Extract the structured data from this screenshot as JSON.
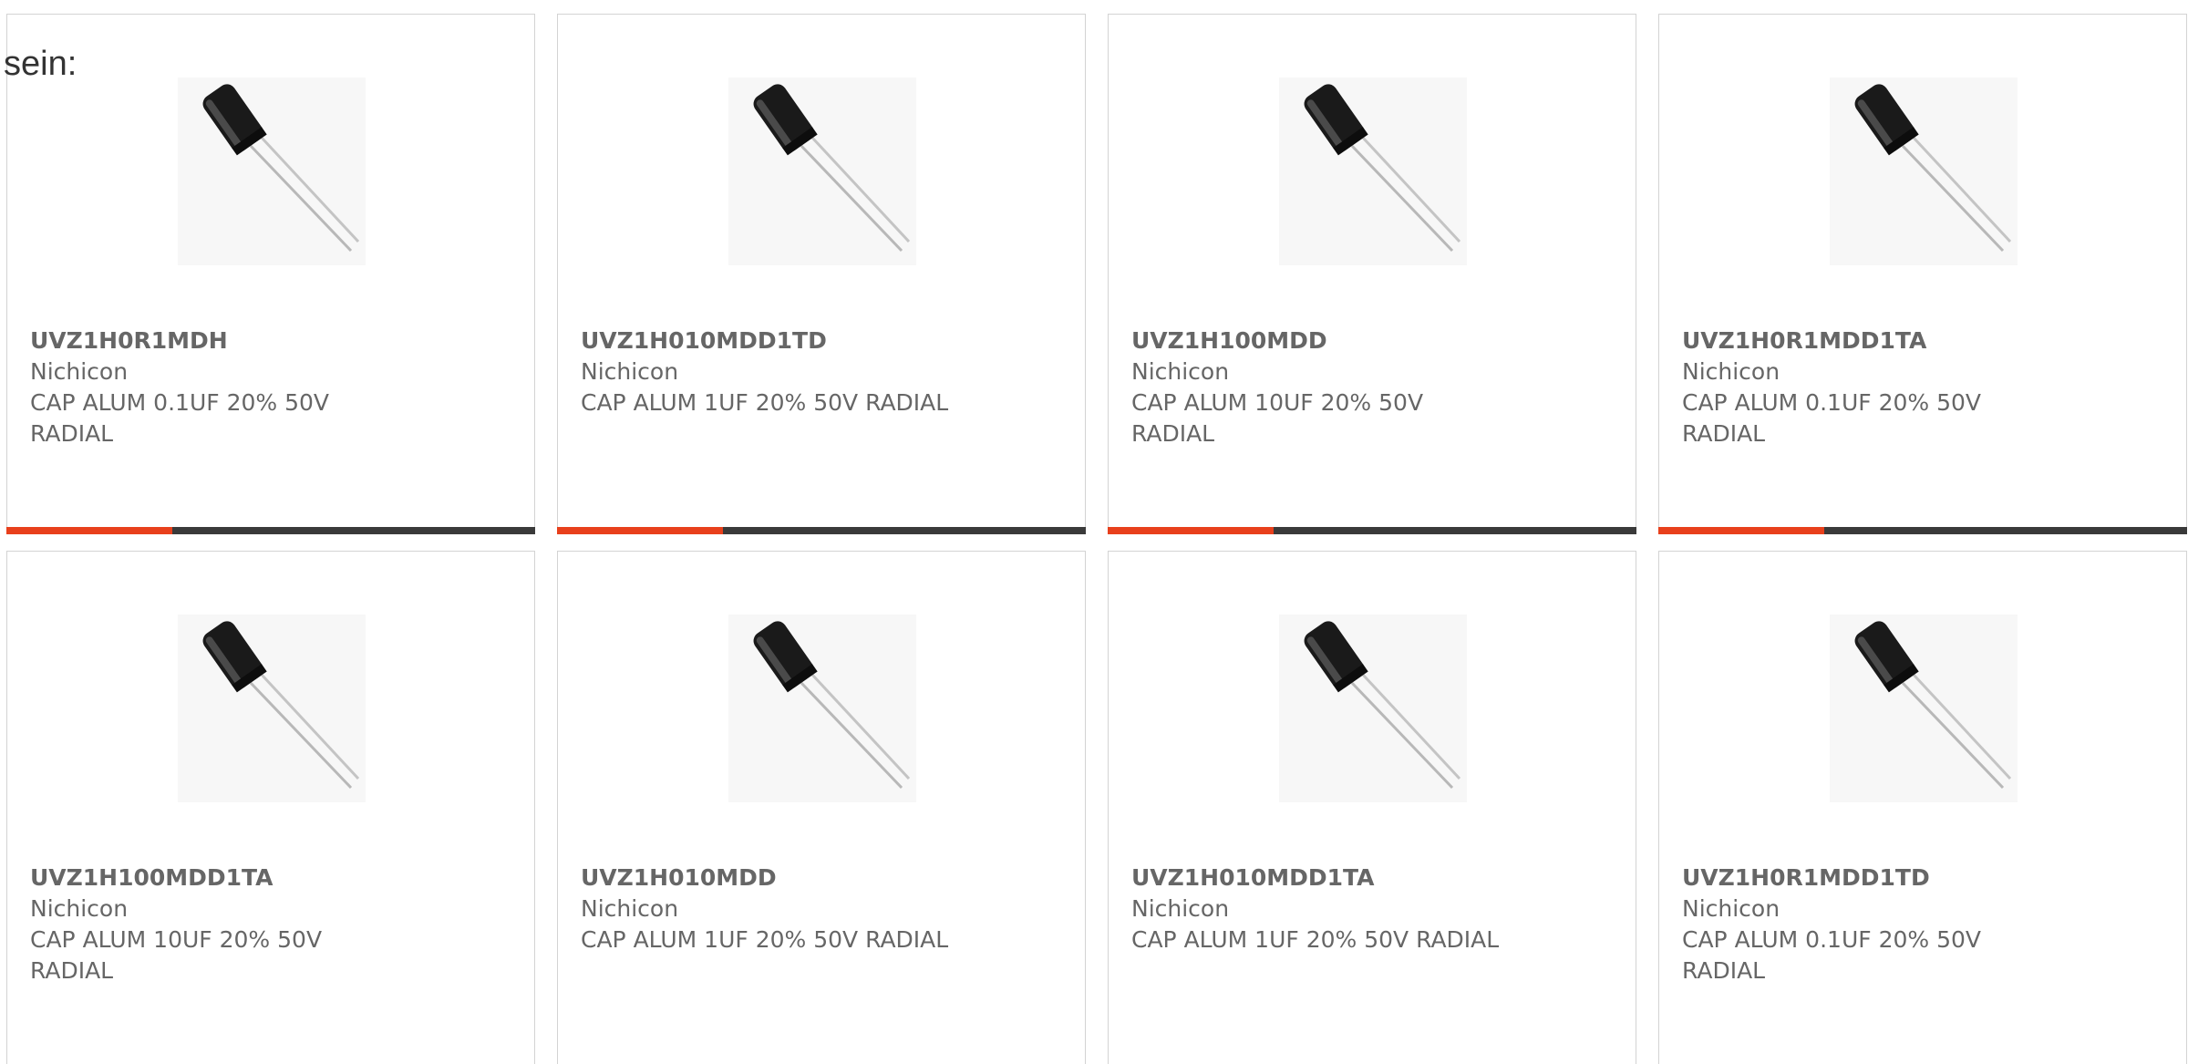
{
  "intro_text": "sein:",
  "colors": {
    "accent": "#e8401c",
    "bar": "#3a3a3a",
    "text": "#666666",
    "border": "#d3d3d3"
  },
  "products": [
    {
      "part": "UVZ1H0R1MDH",
      "maker": "Nichicon",
      "desc": "CAP ALUM 0.1UF 20% 50V RADIAL",
      "icon": "capacitor-image"
    },
    {
      "part": "UVZ1H010MDD1TD",
      "maker": "Nichicon",
      "desc": "CAP ALUM 1UF 20% 50V RADIAL",
      "icon": "capacitor-image"
    },
    {
      "part": "UVZ1H100MDD",
      "maker": "Nichicon",
      "desc": "CAP ALUM 10UF 20% 50V RADIAL",
      "icon": "capacitor-image"
    },
    {
      "part": "UVZ1H0R1MDD1TA",
      "maker": "Nichicon",
      "desc": "CAP ALUM 0.1UF 20% 50V RADIAL",
      "icon": "capacitor-image"
    },
    {
      "part": "UVZ1H100MDD1TA",
      "maker": "Nichicon",
      "desc": "CAP ALUM 10UF 20% 50V RADIAL",
      "icon": "capacitor-image"
    },
    {
      "part": "UVZ1H010MDD",
      "maker": "Nichicon",
      "desc": "CAP ALUM 1UF 20% 50V RADIAL",
      "icon": "capacitor-image"
    },
    {
      "part": "UVZ1H010MDD1TA",
      "maker": "Nichicon",
      "desc": "CAP ALUM 1UF 20% 50V RADIAL",
      "icon": "capacitor-image"
    },
    {
      "part": "UVZ1H0R1MDD1TD",
      "maker": "Nichicon",
      "desc": "CAP ALUM 0.1UF 20% 50V RADIAL",
      "icon": "capacitor-image"
    }
  ]
}
